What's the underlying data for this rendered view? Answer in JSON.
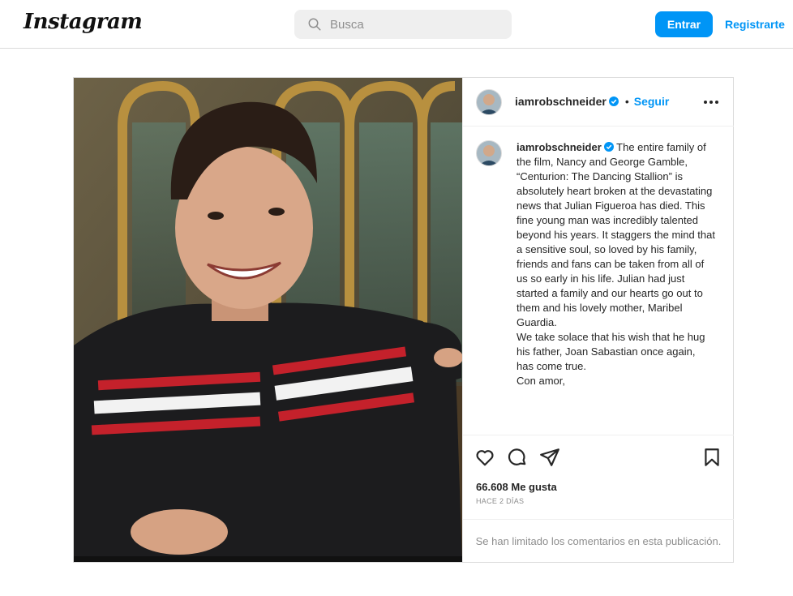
{
  "header": {
    "logo": "Instagram",
    "search_placeholder": "Busca",
    "login_label": "Entrar",
    "signup_label": "Registrarte"
  },
  "post": {
    "username": "iamrobschneider",
    "follow_label": "Seguir",
    "separator": "•",
    "caption": "The entire family of the film, Nancy and George Gamble,\n“Centurion: The Dancing Stallion” is absolutely heart broken at the devastating news that Julian Figueroa has died. This fine young man was incredibly talented beyond his years. It staggers the mind that a sensitive soul, so loved by his family, friends and fans can be taken from all of us so early in his life. Julian had just started a family and our hearts go out to them and his lovely mother, Maribel Guardia.\nWe take solace that his wish that he hug his father, Joan Sabastian once again,\nhas come true.\nCon amor,",
    "likes": "66.608 Me gusta",
    "time": "HACE 2 DÍAS",
    "comments_limited": "Se han limitado los comentarios en esta publicación."
  },
  "icons": {
    "search": "search-icon",
    "verified": "verified-badge-icon",
    "more": "more-options-icon",
    "like": "heart-icon",
    "comment": "comment-icon",
    "share": "share-icon",
    "save": "bookmark-icon"
  },
  "colors": {
    "accent": "#0095f6",
    "text": "#262626",
    "muted": "#8e8e8e",
    "border": "#dbdbdb"
  }
}
